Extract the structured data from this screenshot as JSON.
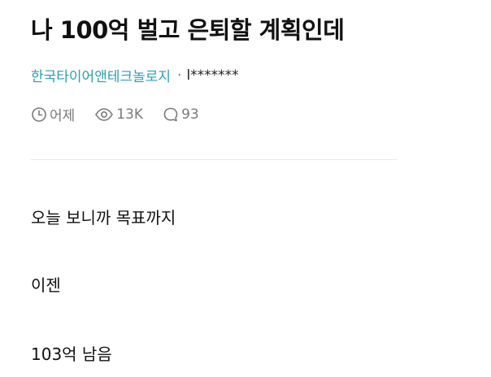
{
  "post": {
    "title": "나 100억 벌고 은퇴할 계획인데",
    "company": "한국타이어앤테크놀로지",
    "separator": "·",
    "author": "l*******",
    "stats": {
      "time": "어제",
      "views": "13K",
      "comments": "93"
    },
    "body_lines": [
      "오늘 보니까 목표까지",
      "이젠",
      "103억 남음"
    ]
  },
  "icons": {
    "time": "clock-icon",
    "views": "eye-icon",
    "comments": "comment-bubble-icon"
  },
  "colors": {
    "company_link": "#2b9fb5",
    "meta_text": "#7a7a7a",
    "title_text": "#111111"
  }
}
